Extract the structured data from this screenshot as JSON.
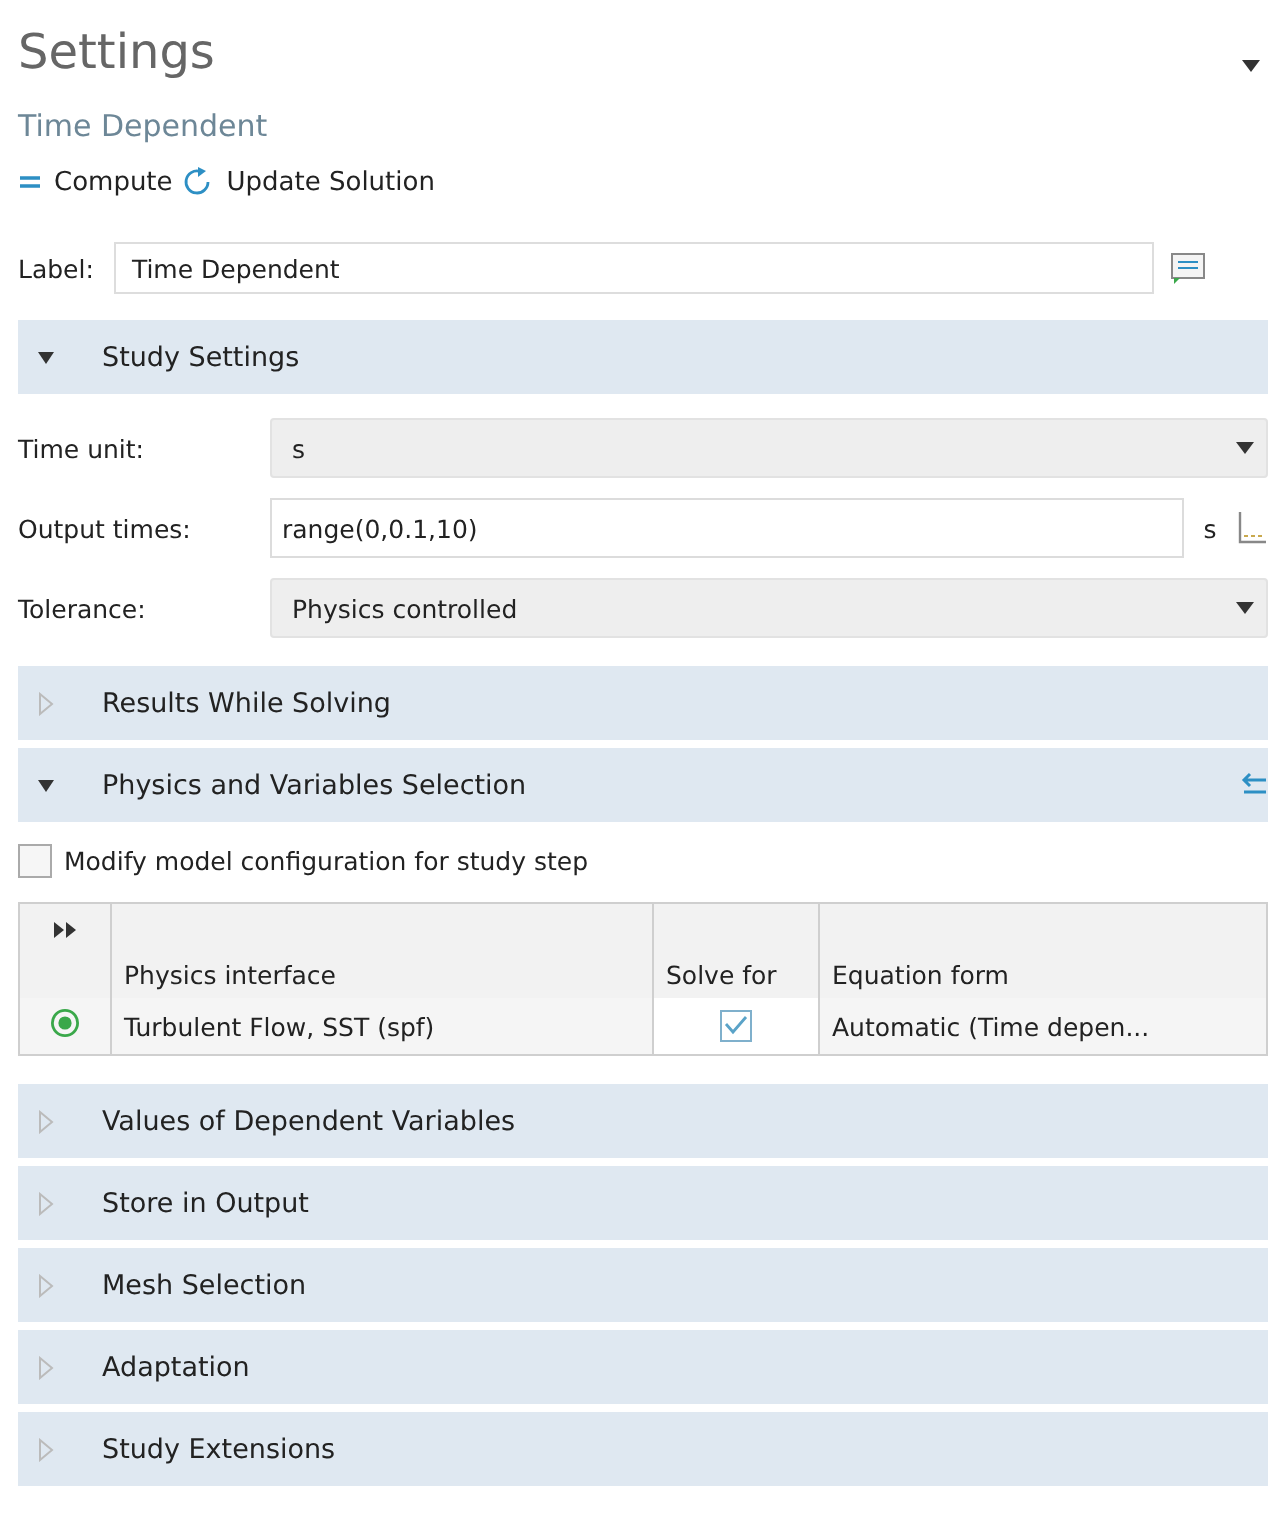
{
  "window": {
    "title": "Settings",
    "subtitle": "Time Dependent"
  },
  "toolbar": [
    {
      "label": "Compute"
    },
    {
      "label": "Update Solution"
    }
  ],
  "label_field": {
    "label": "Label:",
    "value": "Time Dependent"
  },
  "sections": [
    {
      "title": "Study Settings",
      "expanded": true,
      "kind": "fields",
      "fields": [
        {
          "label": "Time unit:",
          "kind": "select",
          "value": "s"
        },
        {
          "label": "Output times:",
          "kind": "input",
          "value": "range(0,0.1,10)",
          "unit": "s"
        },
        {
          "label": "Tolerance:",
          "kind": "select",
          "value": "Physics controlled"
        }
      ]
    },
    {
      "title": "Results While Solving",
      "expanded": false
    },
    {
      "title": "Physics and Variables Selection",
      "expanded": true,
      "kind": "physics",
      "checkbox": {
        "label": "Modify model configuration for study step",
        "checked": false
      },
      "table": {
        "columns": [
          "Physics interface",
          "Solve for",
          "Equation form"
        ],
        "rows": [
          {
            "physics_interface": "Turbulent Flow, SST (spf)",
            "solve_for": true,
            "equation_form": "Automatic (Time depen..."
          }
        ]
      }
    },
    {
      "title": "Values of Dependent Variables",
      "expanded": false
    },
    {
      "title": "Store in Output",
      "expanded": false
    },
    {
      "title": "Mesh Selection",
      "expanded": false
    },
    {
      "title": "Adaptation",
      "expanded": false
    },
    {
      "title": "Study Extensions",
      "expanded": false
    }
  ]
}
